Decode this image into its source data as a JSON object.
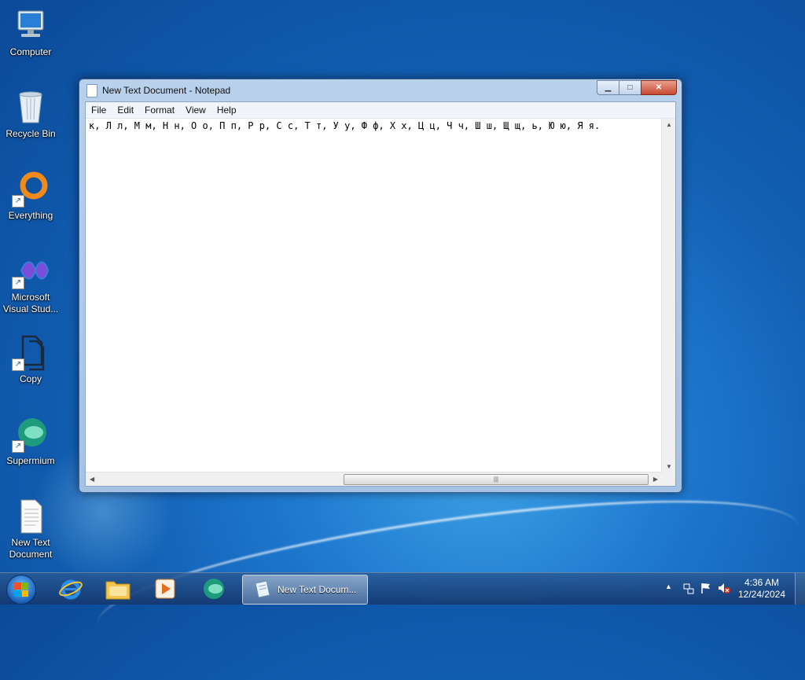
{
  "desktop": {
    "icons": [
      {
        "label": "Computer",
        "icon": "computer-icon"
      },
      {
        "label": "Recycle Bin",
        "icon": "recycle-bin-icon"
      },
      {
        "label": "Everything",
        "icon": "everything-icon"
      },
      {
        "label": "Microsoft Visual Stud...",
        "icon": "visual-studio-icon"
      },
      {
        "label": "Copy",
        "icon": "copy-icon"
      },
      {
        "label": "Supermium",
        "icon": "supermium-icon"
      },
      {
        "label": "New Text Document",
        "icon": "text-document-icon"
      }
    ]
  },
  "window": {
    "title": "New Text Document - Notepad",
    "menu": [
      "File",
      "Edit",
      "Format",
      "View",
      "Help"
    ],
    "content": "к, Л л, М м, Н н, О о, П п, Р р, С с, Т т, У у, Ф ф, Х х, Ц ц, Ч ч, Ш ш, Щ щ, ь, Ю ю, Я я."
  },
  "taskbar": {
    "task_label": "New Text Docum...",
    "time": "4:36 AM",
    "date": "12/24/2024"
  },
  "colors": {
    "desktop_blue": "#125fb3",
    "close_red": "#c74a32"
  }
}
